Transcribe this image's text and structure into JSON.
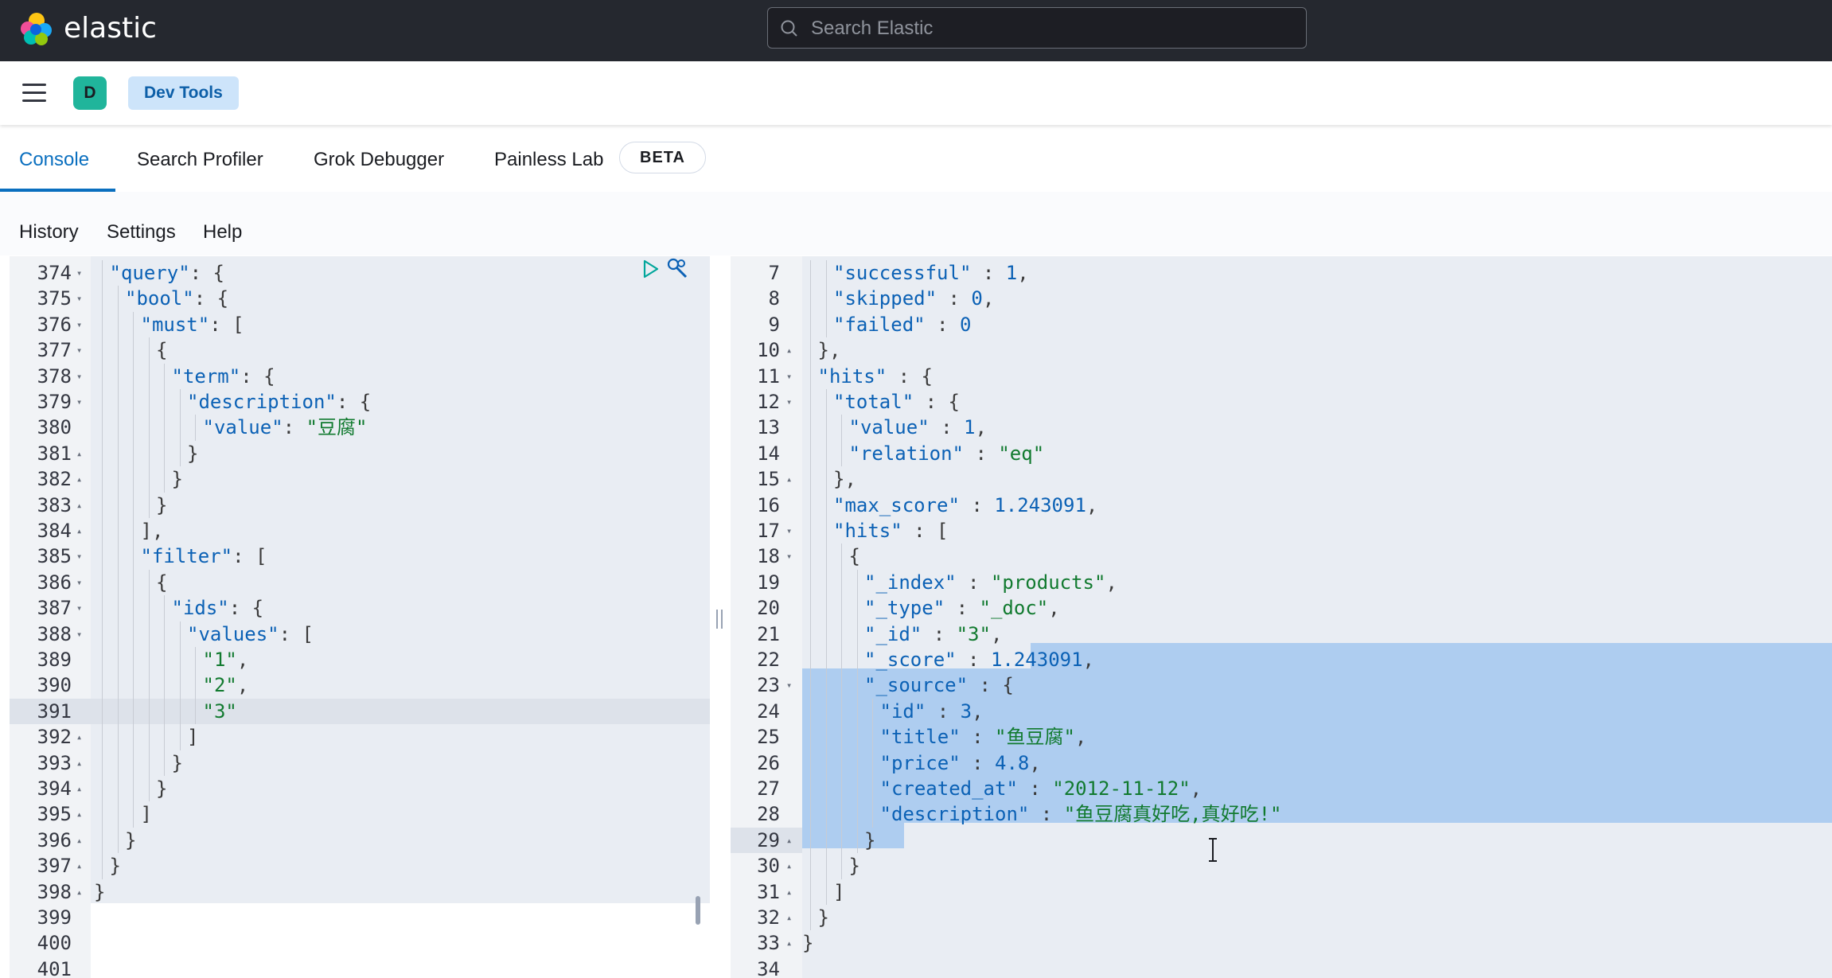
{
  "app": {
    "brand": "elastic"
  },
  "search": {
    "placeholder": "Search Elastic"
  },
  "header": {
    "avatar_initial": "D",
    "breadcrumb": "Dev Tools"
  },
  "tabs": [
    {
      "label": "Console",
      "active": true
    },
    {
      "label": "Search Profiler",
      "active": false
    },
    {
      "label": "Grok Debugger",
      "active": false
    },
    {
      "label": "Painless Lab",
      "active": false
    }
  ],
  "beta_badge": "BETA",
  "console_menu": [
    "History",
    "Settings",
    "Help"
  ],
  "colors": {
    "header_bg": "#25282f",
    "accent": "#0a6fbf",
    "badge_bg": "#cde4fa",
    "avatar_bg": "#20b59b",
    "string": "#117a2f",
    "key": "#0b61b5",
    "selection": "#aecdf0"
  },
  "request_editor": {
    "lines": [
      {
        "n": "374",
        "fold": "▾",
        "depth": 1,
        "tokens": [
          [
            "k",
            "\"query\""
          ],
          [
            "p",
            ": {"
          ]
        ]
      },
      {
        "n": "375",
        "fold": "▾",
        "depth": 2,
        "tokens": [
          [
            "k",
            "\"bool\""
          ],
          [
            "p",
            ": {"
          ]
        ]
      },
      {
        "n": "376",
        "fold": "▾",
        "depth": 3,
        "tokens": [
          [
            "k",
            "\"must\""
          ],
          [
            "p",
            ": ["
          ]
        ]
      },
      {
        "n": "377",
        "fold": "▾",
        "depth": 4,
        "tokens": [
          [
            "p",
            "{"
          ]
        ]
      },
      {
        "n": "378",
        "fold": "▾",
        "depth": 5,
        "tokens": [
          [
            "k",
            "\"term\""
          ],
          [
            "p",
            ": {"
          ]
        ]
      },
      {
        "n": "379",
        "fold": "▾",
        "depth": 6,
        "tokens": [
          [
            "k",
            "\"description\""
          ],
          [
            "p",
            ": {"
          ]
        ]
      },
      {
        "n": "380",
        "fold": "",
        "depth": 7,
        "tokens": [
          [
            "k",
            "\"value\""
          ],
          [
            "p",
            ": "
          ],
          [
            "s",
            "\"豆腐\""
          ]
        ]
      },
      {
        "n": "381",
        "fold": "▴",
        "depth": 6,
        "tokens": [
          [
            "p",
            "}"
          ]
        ]
      },
      {
        "n": "382",
        "fold": "▴",
        "depth": 5,
        "tokens": [
          [
            "p",
            "}"
          ]
        ]
      },
      {
        "n": "383",
        "fold": "▴",
        "depth": 4,
        "tokens": [
          [
            "p",
            "}"
          ]
        ]
      },
      {
        "n": "384",
        "fold": "▴",
        "depth": 3,
        "tokens": [
          [
            "p",
            "],"
          ]
        ]
      },
      {
        "n": "385",
        "fold": "▾",
        "depth": 3,
        "tokens": [
          [
            "k",
            "\"filter\""
          ],
          [
            "p",
            ": ["
          ]
        ]
      },
      {
        "n": "386",
        "fold": "▾",
        "depth": 4,
        "tokens": [
          [
            "p",
            "{"
          ]
        ]
      },
      {
        "n": "387",
        "fold": "▾",
        "depth": 5,
        "tokens": [
          [
            "k",
            "\"ids\""
          ],
          [
            "p",
            ": {"
          ]
        ]
      },
      {
        "n": "388",
        "fold": "▾",
        "depth": 6,
        "tokens": [
          [
            "k",
            "\"values\""
          ],
          [
            "p",
            ": ["
          ]
        ]
      },
      {
        "n": "389",
        "fold": "",
        "depth": 7,
        "tokens": [
          [
            "s",
            "\"1\""
          ],
          [
            "p",
            ","
          ]
        ]
      },
      {
        "n": "390",
        "fold": "",
        "depth": 7,
        "tokens": [
          [
            "s",
            "\"2\""
          ],
          [
            "p",
            ","
          ]
        ]
      },
      {
        "n": "391",
        "fold": "",
        "depth": 7,
        "tokens": [
          [
            "s",
            "\"3\""
          ]
        ],
        "current": true
      },
      {
        "n": "392",
        "fold": "▴",
        "depth": 6,
        "tokens": [
          [
            "p",
            "]"
          ]
        ]
      },
      {
        "n": "393",
        "fold": "▴",
        "depth": 5,
        "tokens": [
          [
            "p",
            "}"
          ]
        ]
      },
      {
        "n": "394",
        "fold": "▴",
        "depth": 4,
        "tokens": [
          [
            "p",
            "}"
          ]
        ]
      },
      {
        "n": "395",
        "fold": "▴",
        "depth": 3,
        "tokens": [
          [
            "p",
            "]"
          ]
        ]
      },
      {
        "n": "396",
        "fold": "▴",
        "depth": 2,
        "tokens": [
          [
            "p",
            "}"
          ]
        ]
      },
      {
        "n": "397",
        "fold": "▴",
        "depth": 1,
        "tokens": [
          [
            "p",
            "}"
          ]
        ]
      },
      {
        "n": "398",
        "fold": "▴",
        "depth": 0,
        "tokens": [
          [
            "p",
            "}"
          ]
        ]
      },
      {
        "n": "399",
        "fold": "",
        "depth": -1,
        "tokens": []
      },
      {
        "n": "400",
        "fold": "",
        "depth": -1,
        "tokens": []
      },
      {
        "n": "401",
        "fold": "",
        "depth": -1,
        "tokens": []
      }
    ]
  },
  "response_editor": {
    "lines": [
      {
        "n": "7",
        "fold": "",
        "depth": 2,
        "tokens": [
          [
            "k",
            "\"successful\""
          ],
          [
            "p",
            " : "
          ],
          [
            "n",
            "1"
          ],
          [
            "p",
            ","
          ]
        ]
      },
      {
        "n": "8",
        "fold": "",
        "depth": 2,
        "tokens": [
          [
            "k",
            "\"skipped\""
          ],
          [
            "p",
            " : "
          ],
          [
            "n",
            "0"
          ],
          [
            "p",
            ","
          ]
        ]
      },
      {
        "n": "9",
        "fold": "",
        "depth": 2,
        "tokens": [
          [
            "k",
            "\"failed\""
          ],
          [
            "p",
            " : "
          ],
          [
            "n",
            "0"
          ]
        ]
      },
      {
        "n": "10",
        "fold": "▴",
        "depth": 1,
        "tokens": [
          [
            "p",
            "},"
          ]
        ]
      },
      {
        "n": "11",
        "fold": "▾",
        "depth": 1,
        "tokens": [
          [
            "k",
            "\"hits\""
          ],
          [
            "p",
            " : {"
          ]
        ]
      },
      {
        "n": "12",
        "fold": "▾",
        "depth": 2,
        "tokens": [
          [
            "k",
            "\"total\""
          ],
          [
            "p",
            " : {"
          ]
        ]
      },
      {
        "n": "13",
        "fold": "",
        "depth": 3,
        "tokens": [
          [
            "k",
            "\"value\""
          ],
          [
            "p",
            " : "
          ],
          [
            "n",
            "1"
          ],
          [
            "p",
            ","
          ]
        ]
      },
      {
        "n": "14",
        "fold": "",
        "depth": 3,
        "tokens": [
          [
            "k",
            "\"relation\""
          ],
          [
            "p",
            " : "
          ],
          [
            "s",
            "\"eq\""
          ]
        ]
      },
      {
        "n": "15",
        "fold": "▴",
        "depth": 2,
        "tokens": [
          [
            "p",
            "},"
          ]
        ]
      },
      {
        "n": "16",
        "fold": "",
        "depth": 2,
        "tokens": [
          [
            "k",
            "\"max_score\""
          ],
          [
            "p",
            " : "
          ],
          [
            "n",
            "1.243091"
          ],
          [
            "p",
            ","
          ]
        ]
      },
      {
        "n": "17",
        "fold": "▾",
        "depth": 2,
        "tokens": [
          [
            "k",
            "\"hits\""
          ],
          [
            "p",
            " : ["
          ]
        ]
      },
      {
        "n": "18",
        "fold": "▾",
        "depth": 3,
        "tokens": [
          [
            "p",
            "{"
          ]
        ]
      },
      {
        "n": "19",
        "fold": "",
        "depth": 4,
        "tokens": [
          [
            "k",
            "\"_index\""
          ],
          [
            "p",
            " : "
          ],
          [
            "s",
            "\"products\""
          ],
          [
            "p",
            ","
          ]
        ]
      },
      {
        "n": "20",
        "fold": "",
        "depth": 4,
        "tokens": [
          [
            "k",
            "\"_type\""
          ],
          [
            "p",
            " : "
          ],
          [
            "s",
            "\"_doc\""
          ],
          [
            "p",
            ","
          ]
        ]
      },
      {
        "n": "21",
        "fold": "",
        "depth": 4,
        "tokens": [
          [
            "k",
            "\"_id\""
          ],
          [
            "p",
            " : "
          ],
          [
            "s",
            "\"3\""
          ],
          [
            "p",
            ","
          ]
        ]
      },
      {
        "n": "22",
        "fold": "",
        "depth": 4,
        "tokens": [
          [
            "k",
            "\"_score\""
          ],
          [
            "p",
            " : "
          ],
          [
            "n",
            "1.243091"
          ],
          [
            "p",
            ","
          ]
        ]
      },
      {
        "n": "23",
        "fold": "▾",
        "depth": 4,
        "tokens": [
          [
            "k",
            "\"_source\""
          ],
          [
            "p",
            " : {"
          ]
        ]
      },
      {
        "n": "24",
        "fold": "",
        "depth": 5,
        "tokens": [
          [
            "k",
            "\"id\""
          ],
          [
            "p",
            " : "
          ],
          [
            "n",
            "3"
          ],
          [
            "p",
            ","
          ]
        ]
      },
      {
        "n": "25",
        "fold": "",
        "depth": 5,
        "tokens": [
          [
            "k",
            "\"title\""
          ],
          [
            "p",
            " : "
          ],
          [
            "s",
            "\"鱼豆腐\""
          ],
          [
            "p",
            ","
          ]
        ]
      },
      {
        "n": "26",
        "fold": "",
        "depth": 5,
        "tokens": [
          [
            "k",
            "\"price\""
          ],
          [
            "p",
            " : "
          ],
          [
            "n",
            "4.8"
          ],
          [
            "p",
            ","
          ]
        ]
      },
      {
        "n": "27",
        "fold": "",
        "depth": 5,
        "tokens": [
          [
            "k",
            "\"created_at\""
          ],
          [
            "p",
            " : "
          ],
          [
            "s",
            "\"2012-11-12\""
          ],
          [
            "p",
            ","
          ]
        ]
      },
      {
        "n": "28",
        "fold": "",
        "depth": 5,
        "tokens": [
          [
            "k",
            "\"description\""
          ],
          [
            "p",
            " : "
          ],
          [
            "s",
            "\"鱼豆腐真好吃,真好吃!\""
          ]
        ]
      },
      {
        "n": "29",
        "fold": "▴",
        "depth": 4,
        "tokens": [
          [
            "p",
            "}"
          ]
        ],
        "current": true
      },
      {
        "n": "30",
        "fold": "▴",
        "depth": 3,
        "tokens": [
          [
            "p",
            "}"
          ]
        ]
      },
      {
        "n": "31",
        "fold": "▴",
        "depth": 2,
        "tokens": [
          [
            "p",
            "]"
          ]
        ]
      },
      {
        "n": "32",
        "fold": "▴",
        "depth": 1,
        "tokens": [
          [
            "p",
            "}"
          ]
        ]
      },
      {
        "n": "33",
        "fold": "▴",
        "depth": 0,
        "tokens": [
          [
            "p",
            "}"
          ]
        ]
      },
      {
        "n": "34",
        "fold": "",
        "depth": -1,
        "tokens": []
      }
    ]
  }
}
